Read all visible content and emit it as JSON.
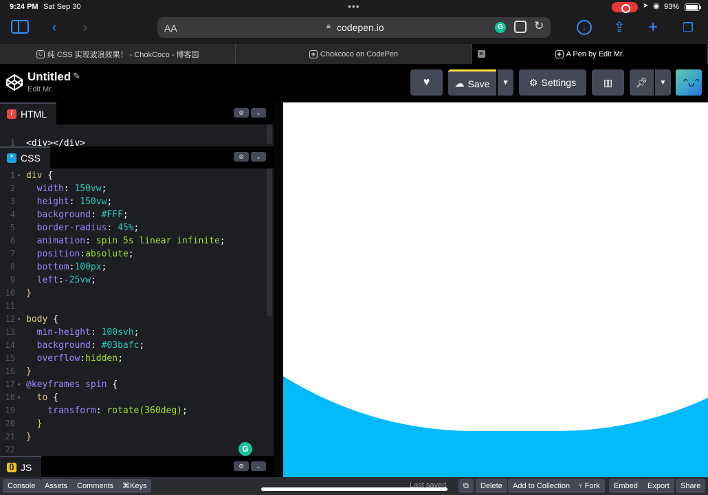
{
  "status_bar": {
    "time": "9:24 PM",
    "date": "Sat Sep 30",
    "battery": "93%"
  },
  "safari": {
    "text_size_label": "AA",
    "url": "codepen.io",
    "tabs": [
      {
        "title": "纯 CSS 实现波浪效果！ - ChokCoco - 博客园",
        "favicon": "C"
      },
      {
        "title": "Chokcoco on CodePen",
        "favicon": "codepen-icon"
      },
      {
        "title": "A Pen by Edit Mr.",
        "favicon": "codepen-icon",
        "active": true
      }
    ]
  },
  "codepen": {
    "title": "Untitled",
    "author": "Edit Mr.",
    "buttons": {
      "save": "Save",
      "settings": "Settings"
    }
  },
  "editor": {
    "html": {
      "label": "HTML",
      "lines": [
        "<div></div>"
      ]
    },
    "css": {
      "label": "CSS",
      "lines": [
        "div {",
        "  width: 150vw;",
        "  height: 150vw;",
        "  background: #FFF;",
        "  border-radius: 45%;",
        "  animation: spin 5s linear infinite;",
        "  position:absolute;",
        "  bottom:100px;",
        "  left:-25vw;",
        "}",
        "",
        "body {",
        "  min-height: 100svh;",
        "  background: #03bafc;",
        "  overflow:hidden;",
        "}",
        "@keyframes spin {",
        "  to {",
        "    transform: rotate(360deg);",
        "  }",
        "}",
        ""
      ]
    },
    "js": {
      "label": "JS"
    }
  },
  "preview": {
    "background": "#03bafc",
    "shape_color": "#FFF"
  },
  "footer": {
    "left_buttons": [
      "Console",
      "Assets",
      "Comments",
      "⌘Keys"
    ],
    "status": "Last saved",
    "right_buttons": [
      "Delete",
      "Add to Collection",
      "Fork",
      "Embed",
      "Export",
      "Share"
    ]
  },
  "colors": {
    "accent_save": "#ffdd40",
    "button_bg": "#444857",
    "editor_bg": "#1d1e22"
  }
}
